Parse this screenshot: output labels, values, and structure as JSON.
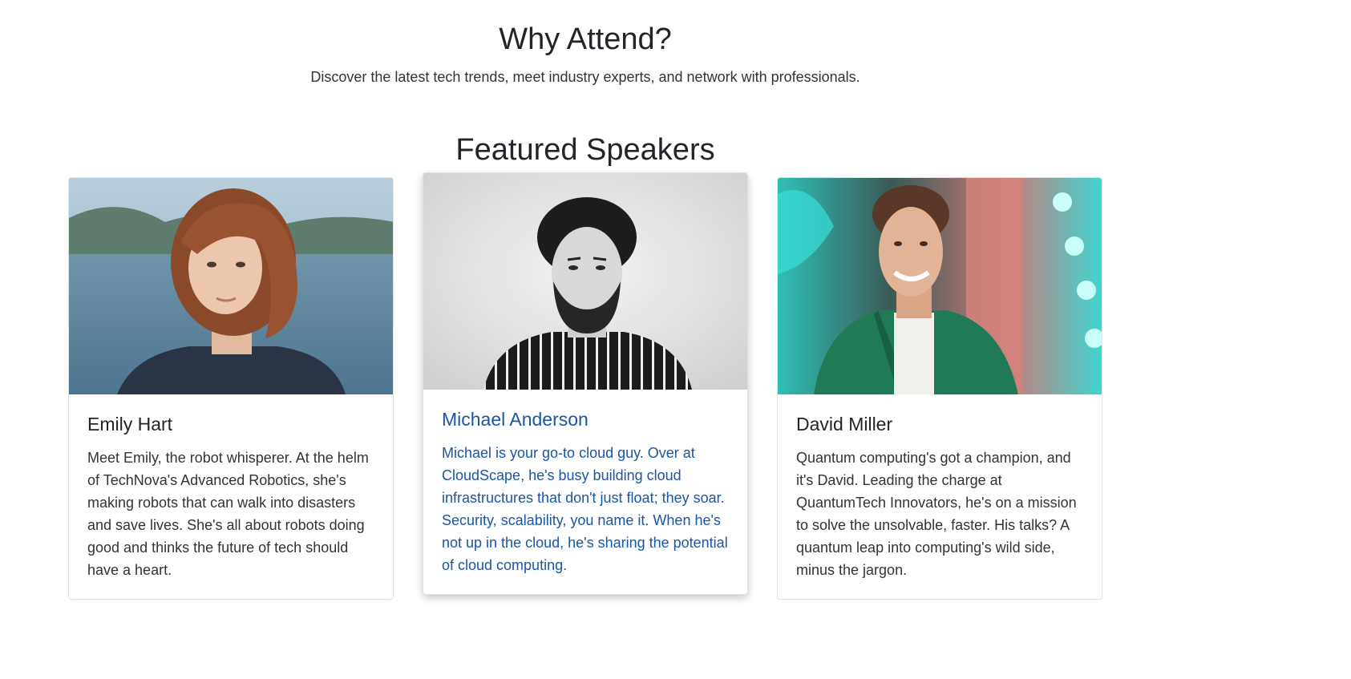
{
  "why": {
    "title": "Why Attend?",
    "subtitle": "Discover the latest tech trends, meet industry experts, and network with professionals."
  },
  "speakers": {
    "title": "Featured Speakers",
    "items": [
      {
        "name": "Emily Hart",
        "bio": "Meet Emily, the robot whisperer. At the helm of TechNova's Advanced Robotics, she's making robots that can walk into disasters and save lives. She's all about robots doing good and thinks the future of tech should have a heart."
      },
      {
        "name": "Michael Anderson",
        "bio": "Michael is your go-to cloud guy. Over at CloudScape, he's busy building cloud infrastructures that don't just float; they soar. Security, scalability, you name it. When he's not up in the cloud, he's sharing the potential of cloud computing."
      },
      {
        "name": "David Miller",
        "bio": "Quantum computing's got a champion, and it's David. Leading the charge at QuantumTech Innovators, he's on a mission to solve the unsolvable, faster. His talks? A quantum leap into computing's wild side, minus the jargon."
      }
    ]
  },
  "colors": {
    "highlight_text": "#1a55a6",
    "card_border": "#dfe2e6"
  }
}
